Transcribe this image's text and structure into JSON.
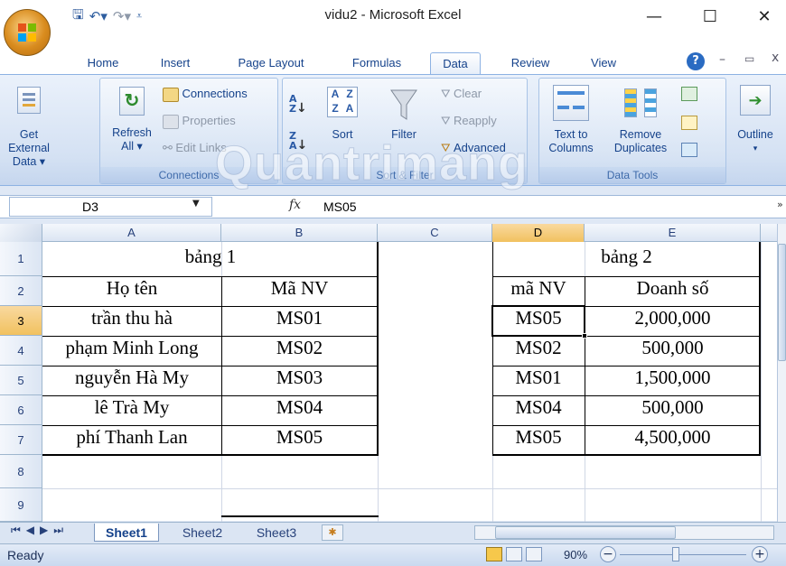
{
  "window": {
    "title": "vidu2 - Microsoft Excel",
    "minimize": "—",
    "maximize": "☐",
    "close": "✕"
  },
  "ribbon_tabs": [
    {
      "label": "Home"
    },
    {
      "label": "Insert"
    },
    {
      "label": "Page Layout"
    },
    {
      "label": "Formulas"
    },
    {
      "label": "Data",
      "active": true
    },
    {
      "label": "Review"
    },
    {
      "label": "View"
    }
  ],
  "ribbon": {
    "get_external": {
      "line1": "Get External",
      "line2": "Data ▾"
    },
    "connections_group": {
      "refresh_line1": "Refresh",
      "refresh_line2": "All ▾",
      "connections": "Connections",
      "properties": "Properties",
      "edit_links": "Edit Links",
      "label": "Connections"
    },
    "sort_filter_group": {
      "sort": "Sort",
      "filter": "Filter",
      "clear": "Clear",
      "reapply": "Reapply",
      "advanced": "Advanced",
      "label": "Sort & Filter"
    },
    "data_tools_group": {
      "text_line1": "Text to",
      "text_line2": "Columns",
      "remove_line1": "Remove",
      "remove_line2": "Duplicates",
      "label": "Data Tools"
    },
    "outline": {
      "label": "Outline",
      "arrow": "▾"
    }
  },
  "formula_bar": {
    "name_box": "D3",
    "fx": "fx",
    "value": "MS05"
  },
  "watermark": "Quantrimang",
  "columns": [
    "A",
    "B",
    "C",
    "D",
    "E"
  ],
  "rows": [
    "1",
    "2",
    "3",
    "4",
    "5",
    "6",
    "7",
    "8",
    "9"
  ],
  "table1": {
    "title": "bảng 1",
    "headers": [
      "Họ tên",
      "Mã NV"
    ],
    "rows": [
      [
        "trần thu hà",
        "MS01"
      ],
      [
        "phạm Minh Long",
        "MS02"
      ],
      [
        "nguyễn Hà My",
        "MS03"
      ],
      [
        "lê Trà My",
        "MS04"
      ],
      [
        "phí Thanh Lan",
        "MS05"
      ]
    ]
  },
  "table2": {
    "title": "bảng 2",
    "headers": [
      "mã NV",
      "Doanh số"
    ],
    "rows": [
      [
        "MS05",
        "2,000,000"
      ],
      [
        "MS02",
        "500,000"
      ],
      [
        "MS01",
        "1,500,000"
      ],
      [
        "MS04",
        "500,000"
      ],
      [
        "MS05",
        "4,500,000"
      ]
    ]
  },
  "sheets": [
    {
      "label": "Sheet1",
      "active": true
    },
    {
      "label": "Sheet2"
    },
    {
      "label": "Sheet3"
    }
  ],
  "status": {
    "ready": "Ready",
    "zoom": "90%",
    "minus": "−",
    "plus": "+"
  },
  "colors": {
    "accent": "#15428b",
    "ribbon": "#d4e1f3",
    "selected_header": "#f1c15f"
  }
}
